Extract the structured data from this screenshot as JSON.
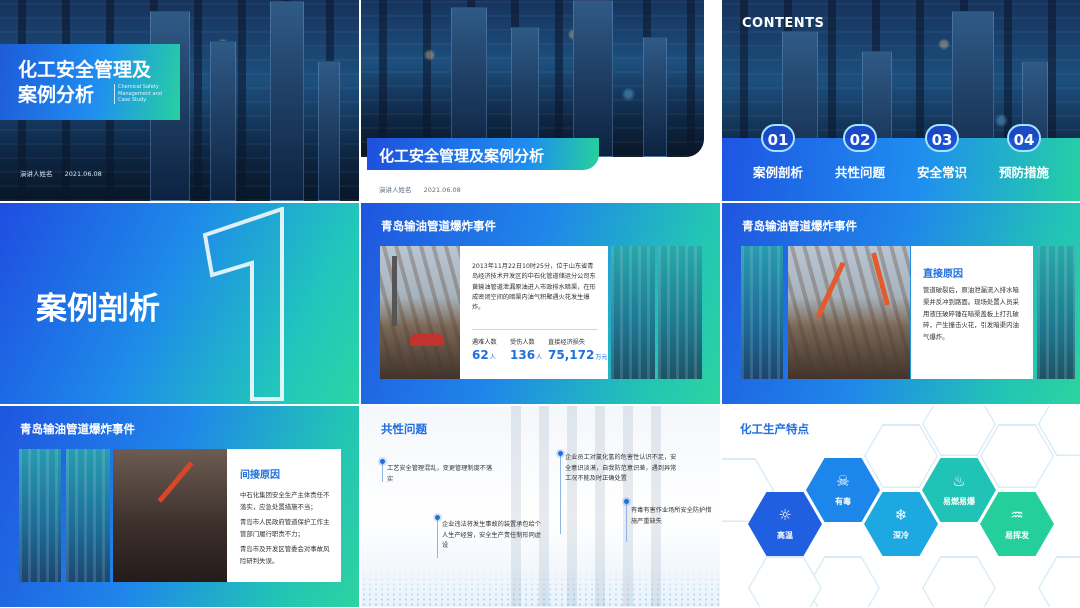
{
  "slide1": {
    "title": "化工安全管理及案例分析",
    "subtitle_en": "Chemical Safety Management and Case Study",
    "presenter": "演讲人姓名",
    "date": "2021.06.08"
  },
  "slide2": {
    "title": "化工安全管理及案例分析",
    "presenter": "演讲人姓名",
    "date": "2021.06.08"
  },
  "slide3": {
    "heading": "CONTENTS",
    "items": [
      {
        "num": "01",
        "label": "案例剖析"
      },
      {
        "num": "02",
        "label": "共性问题"
      },
      {
        "num": "03",
        "label": "安全常识"
      },
      {
        "num": "04",
        "label": "预防措施"
      }
    ]
  },
  "slide4": {
    "chapter": "案例剖析"
  },
  "slide5": {
    "title": "青岛输油管道爆炸事件",
    "paragraph": "2013年11月22日10时25分，位于山东省青岛经济技术开发区的中石化管道储运分公司东黄输油管道泄漏原油进入市政排水暗渠，在形成密闭空间的暗渠内油气积聚遇火花发生爆炸。",
    "stats": [
      {
        "label": "遇难人数",
        "value": "62",
        "unit": "人"
      },
      {
        "label": "受伤人数",
        "value": "136",
        "unit": "人"
      },
      {
        "label": "直接经济损失",
        "value": "75,172",
        "unit": "万元"
      }
    ]
  },
  "slide6": {
    "title": "青岛输油管道爆炸事件",
    "subheading": "直接原因",
    "body": "管道破裂后，原油泄漏流入排水暗渠并反冲到路面。现场处置人员采用液压破碎锤在暗渠盖板上打孔破碎，产生撞击火花，引发暗渠内油气爆炸。"
  },
  "slide7": {
    "title": "青岛输油管道爆炸事件",
    "subheading": "间接原因",
    "points": [
      "中石化集团安全生产主体责任不落实，应急处置措施不当；",
      "青岛市人民政府管道保护工作主管部门履行职责不力；",
      "青岛市及开发区管委会对事故风险研判失误。"
    ]
  },
  "slide8": {
    "title": "共性问题",
    "points": [
      "工艺安全管理混乱，变更管理制度不落实",
      "企业违法将发生事故的装置承包给个人生产经营，安全生产责任制形同虚设",
      "企业员工对氯化氢的危害性认识不足，安全意识淡漠，自我防范意识差，遇到异常工况不能及时正确处置",
      "有毒有害作业场所安全防护措施严重缺失"
    ]
  },
  "slide9": {
    "title": "化工生产特点",
    "features": [
      {
        "label": "高温",
        "icon": "high-temperature-icon",
        "color": "#1f5fe0"
      },
      {
        "label": "有毒",
        "icon": "toxic-icon",
        "color": "#1c86ea"
      },
      {
        "label": "深冷",
        "icon": "cryogenic-icon",
        "color": "#1da8e2"
      },
      {
        "label": "易燃易爆",
        "icon": "flammable-icon",
        "color": "#20c4b6"
      },
      {
        "label": "易挥发",
        "icon": "volatile-icon",
        "color": "#25cf9c"
      }
    ]
  },
  "colors": {
    "primary_blue": "#1f55df",
    "accent_teal": "#2dd3a0",
    "text_blue": "#1f6fe0"
  }
}
